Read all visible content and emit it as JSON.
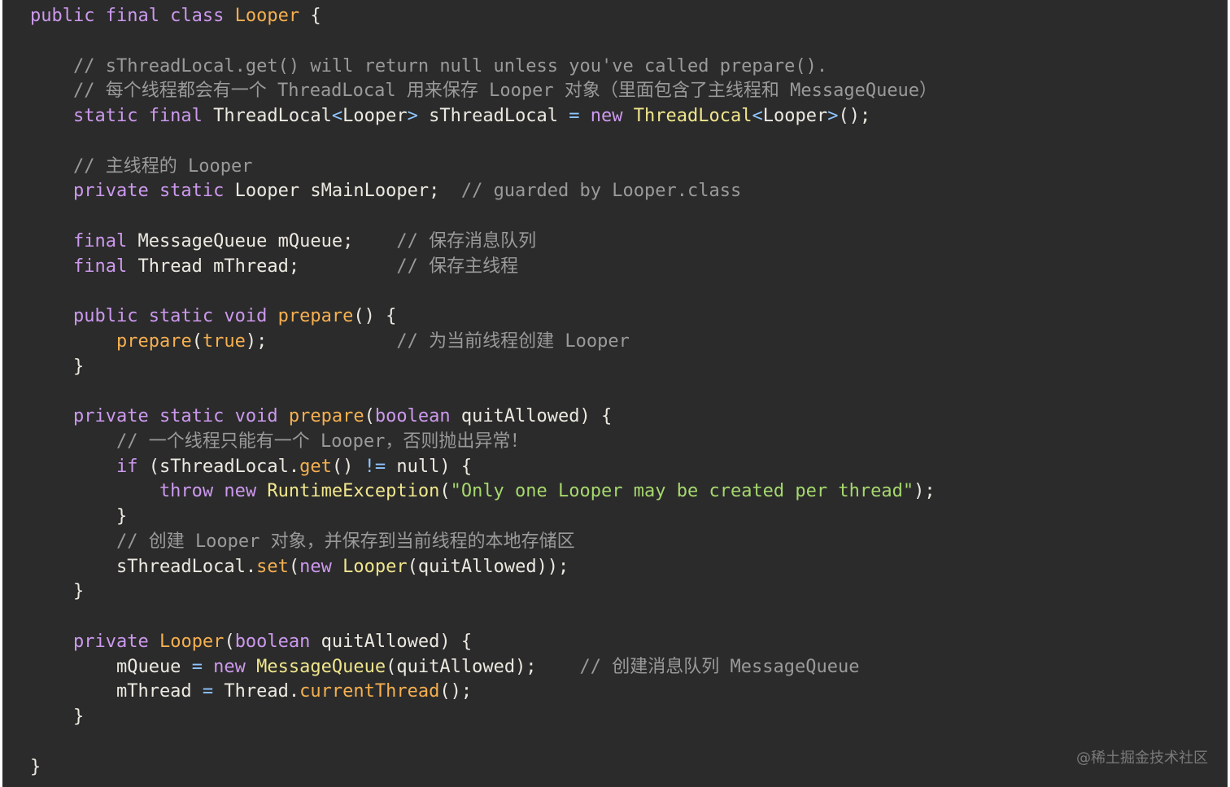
{
  "code": {
    "language": "java",
    "lines": [
      [
        {
          "t": "public final class ",
          "c": "kw"
        },
        {
          "t": "Looper",
          "c": "fn"
        },
        {
          "t": " {",
          "c": ""
        }
      ],
      [],
      [
        {
          "t": "    // sThreadLocal.get() will return null unless you've called prepare().",
          "c": "cm"
        }
      ],
      [
        {
          "t": "    // 每个线程都会有一个 ThreadLocal 用来保存 Looper 对象（里面包含了主线程和 MessageQueue）",
          "c": "cm"
        }
      ],
      [
        {
          "t": "    static final ",
          "c": "kw"
        },
        {
          "t": "ThreadLocal",
          "c": ""
        },
        {
          "t": "<",
          "c": "op"
        },
        {
          "t": "Looper",
          "c": ""
        },
        {
          "t": ">",
          "c": "op"
        },
        {
          "t": " sThreadLocal ",
          "c": ""
        },
        {
          "t": "=",
          "c": "op"
        },
        {
          "t": " new ",
          "c": "kw"
        },
        {
          "t": "ThreadLocal",
          "c": "cls"
        },
        {
          "t": "<",
          "c": "op"
        },
        {
          "t": "Looper",
          "c": ""
        },
        {
          "t": ">",
          "c": "op"
        },
        {
          "t": "();",
          "c": ""
        }
      ],
      [],
      [
        {
          "t": "    // 主线程的 Looper",
          "c": "cm"
        }
      ],
      [
        {
          "t": "    private static ",
          "c": "kw"
        },
        {
          "t": "Looper sMainLooper;  ",
          "c": ""
        },
        {
          "t": "// guarded by Looper.class",
          "c": "cm"
        }
      ],
      [],
      [
        {
          "t": "    final ",
          "c": "kw"
        },
        {
          "t": "MessageQueue mQueue;    ",
          "c": ""
        },
        {
          "t": "// 保存消息队列",
          "c": "cm"
        }
      ],
      [
        {
          "t": "    final ",
          "c": "kw"
        },
        {
          "t": "Thread mThread;         ",
          "c": ""
        },
        {
          "t": "// 保存主线程",
          "c": "cm"
        }
      ],
      [],
      [
        {
          "t": "    public static void ",
          "c": "kw"
        },
        {
          "t": "prepare",
          "c": "fn"
        },
        {
          "t": "() {",
          "c": ""
        }
      ],
      [
        {
          "t": "        ",
          "c": ""
        },
        {
          "t": "prepare",
          "c": "fn"
        },
        {
          "t": "(",
          "c": ""
        },
        {
          "t": "true",
          "c": "fn"
        },
        {
          "t": ");            ",
          "c": ""
        },
        {
          "t": "// 为当前线程创建 Looper",
          "c": "cm"
        }
      ],
      [
        {
          "t": "    }",
          "c": ""
        }
      ],
      [],
      [
        {
          "t": "    private static void ",
          "c": "kw"
        },
        {
          "t": "prepare",
          "c": "fn"
        },
        {
          "t": "(",
          "c": ""
        },
        {
          "t": "boolean",
          "c": "kw"
        },
        {
          "t": " quitAllowed) {",
          "c": ""
        }
      ],
      [
        {
          "t": "        // 一个线程只能有一个 Looper，否则抛出异常！",
          "c": "cm"
        }
      ],
      [
        {
          "t": "        if ",
          "c": "kw"
        },
        {
          "t": "(sThreadLocal.",
          "c": ""
        },
        {
          "t": "get",
          "c": "fn"
        },
        {
          "t": "() ",
          "c": ""
        },
        {
          "t": "!=",
          "c": "op"
        },
        {
          "t": " null) {",
          "c": ""
        }
      ],
      [
        {
          "t": "            throw new ",
          "c": "kw"
        },
        {
          "t": "RuntimeException",
          "c": "cls"
        },
        {
          "t": "(",
          "c": ""
        },
        {
          "t": "\"Only one Looper may be created per thread\"",
          "c": "str"
        },
        {
          "t": ");",
          "c": ""
        }
      ],
      [
        {
          "t": "        }",
          "c": ""
        }
      ],
      [
        {
          "t": "        // 创建 Looper 对象，并保存到当前线程的本地存储区",
          "c": "cm"
        }
      ],
      [
        {
          "t": "        sThreadLocal.",
          "c": ""
        },
        {
          "t": "set",
          "c": "fn"
        },
        {
          "t": "(",
          "c": ""
        },
        {
          "t": "new ",
          "c": "kw"
        },
        {
          "t": "Looper",
          "c": "cls"
        },
        {
          "t": "(quitAllowed));",
          "c": ""
        }
      ],
      [
        {
          "t": "    }",
          "c": ""
        }
      ],
      [],
      [
        {
          "t": "    private ",
          "c": "kw"
        },
        {
          "t": "Looper",
          "c": "fn"
        },
        {
          "t": "(",
          "c": ""
        },
        {
          "t": "boolean",
          "c": "kw"
        },
        {
          "t": " quitAllowed) {",
          "c": ""
        }
      ],
      [
        {
          "t": "        mQueue ",
          "c": ""
        },
        {
          "t": "=",
          "c": "op"
        },
        {
          "t": " new ",
          "c": "kw"
        },
        {
          "t": "MessageQueue",
          "c": "cls"
        },
        {
          "t": "(quitAllowed);    ",
          "c": ""
        },
        {
          "t": "// 创建消息队列 MessageQueue",
          "c": "cm"
        }
      ],
      [
        {
          "t": "        mThread ",
          "c": ""
        },
        {
          "t": "=",
          "c": "op"
        },
        {
          "t": " Thread.",
          "c": ""
        },
        {
          "t": "currentThread",
          "c": "fn"
        },
        {
          "t": "();",
          "c": ""
        }
      ],
      [
        {
          "t": "    }",
          "c": ""
        }
      ],
      [],
      [
        {
          "t": "}",
          "c": ""
        }
      ]
    ]
  },
  "watermark": "@稀土掘金技术社区"
}
